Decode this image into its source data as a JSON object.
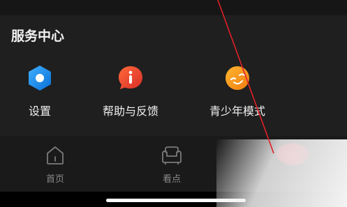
{
  "service_section": {
    "title": "服务中心",
    "items": [
      {
        "label": "设置",
        "icon": "settings-hexagon-icon",
        "color": "#1e8ee8"
      },
      {
        "label": "帮助与反馈",
        "icon": "help-info-bubble-icon",
        "color": "#e8432a"
      },
      {
        "label": "青少年模式",
        "icon": "teen-mode-face-icon",
        "color": "#f0961c"
      }
    ]
  },
  "bottom_nav": {
    "items": [
      {
        "label": "首页",
        "icon": "home-icon"
      },
      {
        "label": "看点",
        "icon": "sofa-icon"
      }
    ]
  },
  "colors": {
    "background": "#1f1f1f",
    "nav_background": "#1a1a1a",
    "annotation_line": "#e0202a"
  }
}
